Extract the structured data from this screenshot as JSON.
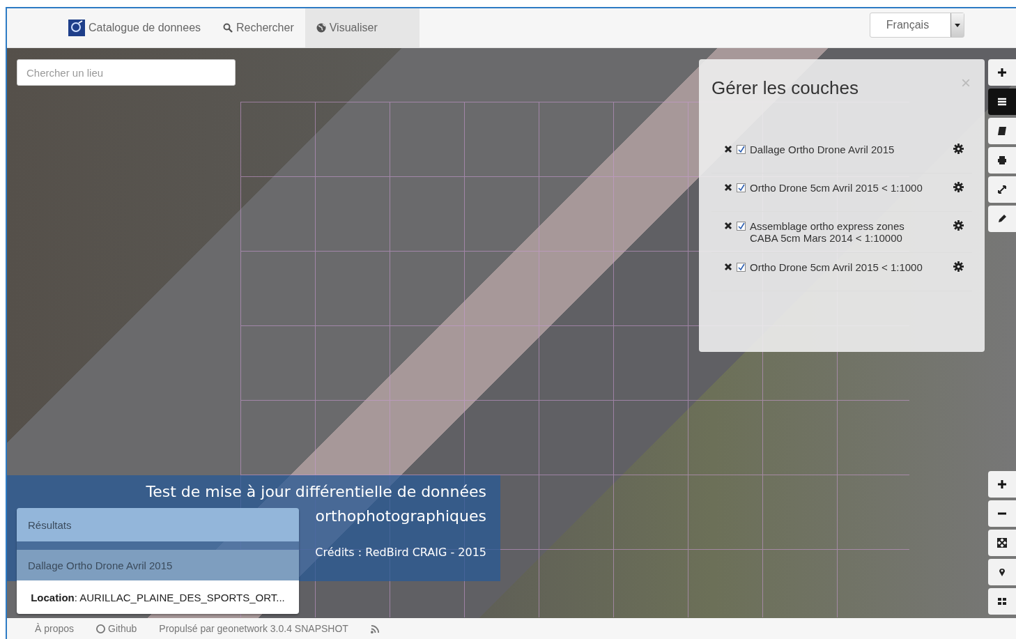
{
  "header": {
    "brand": "Catalogue de donnees",
    "tabs": [
      {
        "label": "Rechercher",
        "selected": false
      },
      {
        "label": "Visualiser",
        "selected": true
      }
    ],
    "language": "Français"
  },
  "map": {
    "search": {
      "placeholder": "Chercher un lieu"
    },
    "layers_panel": {
      "title": "Gérer les couches",
      "close": "×",
      "layers": [
        {
          "name": "Dallage Ortho Drone Avril 2015",
          "checked": true
        },
        {
          "name": "Ortho Drone 5cm Avril 2015 < 1:1000",
          "checked": true
        },
        {
          "name": "Assemblage ortho express zones CABA 5cm Mars 2014 < 1:10000",
          "checked": true
        },
        {
          "name": "Ortho Drone 5cm Avril 2015 < 1:1000",
          "checked": true
        }
      ]
    },
    "results": {
      "heading": "Résultats",
      "item": "Dallage Ortho Drone Avril 2015",
      "location_label": "Location",
      "location_value": ": AURILLAC_PLAINE_DES_SPORTS_ORT..."
    },
    "caption": {
      "title": "Test de mise à jour différentielle de données orthophotographiques",
      "credits": "Crédits : RedBird CRAIG - 2015"
    }
  },
  "footer": {
    "links": [
      "À propos",
      "Github",
      "Propulsé par geonetwork 3.0.4 SNAPSHOT"
    ]
  }
}
